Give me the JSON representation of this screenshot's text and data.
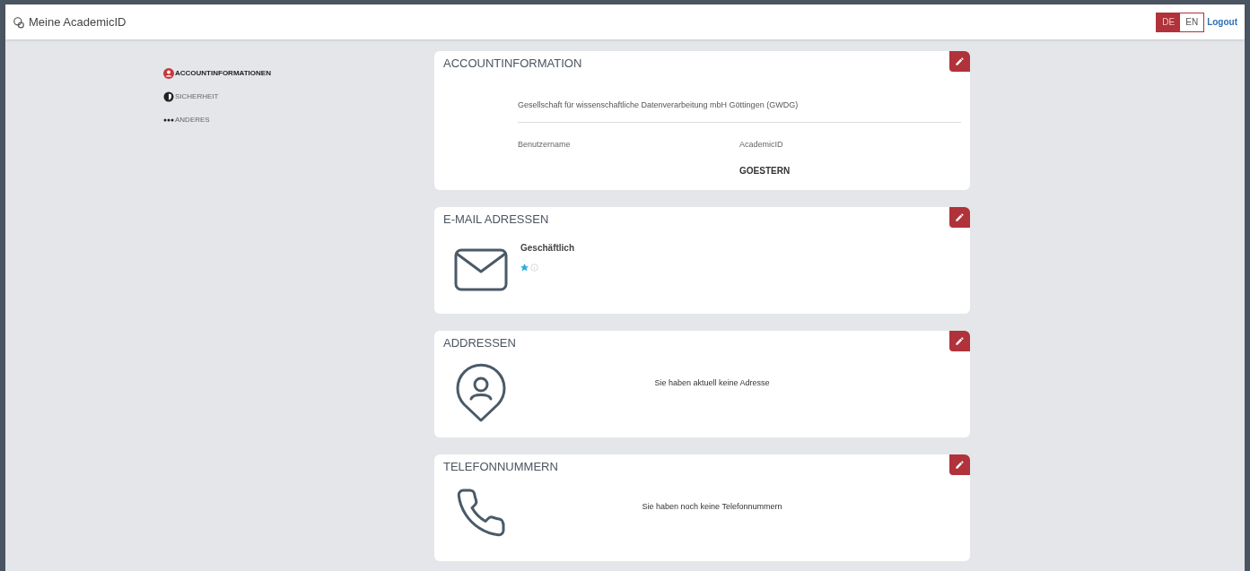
{
  "header": {
    "title": "Meine AcademicID",
    "languages": [
      {
        "label": "DE",
        "selected": true
      },
      {
        "label": "EN",
        "selected": false
      }
    ],
    "logout": "Logout"
  },
  "nav": [
    {
      "label": "ACCOUNTINFORMATIONEN",
      "kind": "user",
      "selected": true
    },
    {
      "label": "SICHERHEIT",
      "kind": "shield",
      "selected": false
    },
    {
      "label": "ANDERES",
      "kind": "dots",
      "selected": false
    }
  ],
  "cards": [
    {
      "kind": "account",
      "title": "ACCOUNTINFORMATION",
      "organization": "Gesellschaft für wissenschaftliche Datenverarbeitung mbH Göttingen (GWDG)",
      "fields": [
        {
          "label": "Benutzername"
        },
        {
          "label": "AcademicID",
          "value": "GOESTERN"
        }
      ]
    },
    {
      "kind": "email",
      "title": "E-MAIL ADRESSEN",
      "entries": [
        {
          "label": "Geschäftlich",
          "primary": true
        }
      ]
    },
    {
      "kind": "address",
      "title": "ADDRESSEN",
      "message": "Sie haben aktuell keine Adresse"
    },
    {
      "kind": "phone",
      "title": "TELEFONNUMMERN",
      "message": "Sie haben noch keine Telefonnummern"
    }
  ]
}
